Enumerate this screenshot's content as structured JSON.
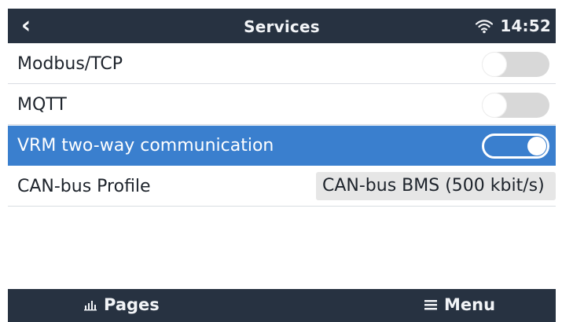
{
  "header": {
    "back_icon": "chevron-left-icon",
    "title": "Services",
    "wifi_icon": "wifi-icon",
    "time": "14:52"
  },
  "services": {
    "rows": [
      {
        "label": "Modbus/TCP",
        "control": "toggle",
        "state": "off"
      },
      {
        "label": "MQTT",
        "control": "toggle",
        "state": "off"
      },
      {
        "label": "VRM two-way communication",
        "control": "toggle",
        "state": "on",
        "selected": true
      },
      {
        "label": "CAN-bus Profile",
        "control": "value",
        "value": "CAN-bus BMS (500 kbit/s)"
      }
    ]
  },
  "footer": {
    "pages_icon": "bar-chart-icon",
    "pages_label": "Pages",
    "menu_icon": "menu-icon",
    "menu_label": "Menu"
  },
  "colors": {
    "header_bg": "#273241",
    "selected_row": "#3a7fce",
    "toggle_off": "#d8d8d8",
    "value_box": "#e6e6e6",
    "text_dark": "#1d232b",
    "text_light": "#ffffff"
  }
}
